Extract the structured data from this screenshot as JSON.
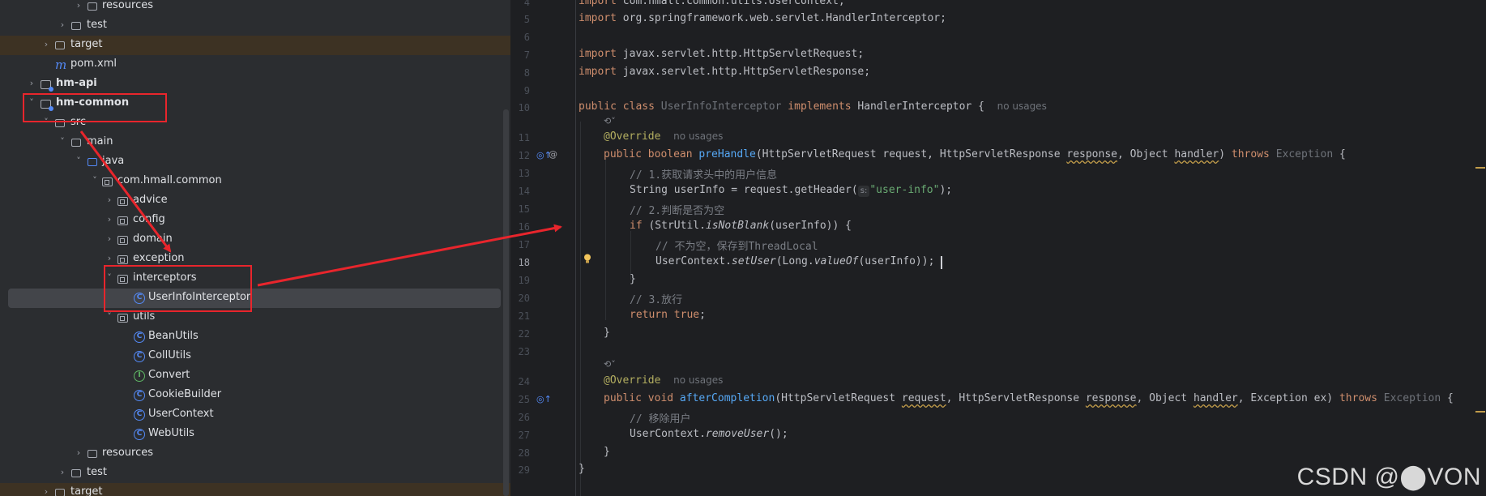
{
  "tree": {
    "items": [
      {
        "label": "resources",
        "icon": "folder-icon"
      },
      {
        "label": "test",
        "icon": "folder-icon"
      },
      {
        "label": "target",
        "icon": "folder-icon"
      },
      {
        "label": "pom.xml",
        "icon": "maven-icon"
      },
      {
        "label": "hm-api",
        "icon": "module-icon"
      },
      {
        "label": "hm-common",
        "icon": "module-icon"
      },
      {
        "label": "src",
        "icon": "folder-icon"
      },
      {
        "label": "main",
        "icon": "folder-icon"
      },
      {
        "label": "java",
        "icon": "source-folder-icon"
      },
      {
        "label": "com.hmall.common",
        "icon": "package-icon"
      },
      {
        "label": "advice",
        "icon": "package-icon"
      },
      {
        "label": "config",
        "icon": "package-icon"
      },
      {
        "label": "domain",
        "icon": "package-icon"
      },
      {
        "label": "exception",
        "icon": "package-icon"
      },
      {
        "label": "interceptors",
        "icon": "package-icon"
      },
      {
        "label": "UserInfoInterceptor",
        "icon": "class-icon"
      },
      {
        "label": "utils",
        "icon": "package-icon"
      },
      {
        "label": "BeanUtils",
        "icon": "class-icon"
      },
      {
        "label": "CollUtils",
        "icon": "class-icon"
      },
      {
        "label": "Convert",
        "icon": "interface-icon"
      },
      {
        "label": "CookieBuilder",
        "icon": "class-icon"
      },
      {
        "label": "UserContext",
        "icon": "class-icon"
      },
      {
        "label": "WebUtils",
        "icon": "class-icon"
      },
      {
        "label": "resources",
        "icon": "folder-icon"
      },
      {
        "label": "test",
        "icon": "folder-icon"
      },
      {
        "label": "target",
        "icon": "folder-icon"
      }
    ]
  },
  "editor": {
    "line_numbers": [
      "4",
      "5",
      "6",
      "7",
      "8",
      "9",
      "10",
      "11",
      "12",
      "13",
      "14",
      "15",
      "16",
      "17",
      "18",
      "19",
      "20",
      "21",
      "22",
      "23",
      "24",
      "25",
      "26",
      "27",
      "28",
      "29"
    ],
    "current_line": "18",
    "lines": {
      "l4_a": "import ",
      "l4_b": "com.hmall.common.utils.UserContext;",
      "l5_a": "import ",
      "l5_b": "org.springframework.web.servlet.HandlerInterceptor;",
      "l7_a": "import ",
      "l7_b": "javax.servlet.http.HttpServletRequest;",
      "l8_a": "import ",
      "l8_b": "javax.servlet.http.HttpServletResponse;",
      "l10_a": "public class ",
      "l10_b": "UserInfoInterceptor",
      "l10_c": " implements ",
      "l10_d": "HandlerInterceptor {",
      "l10_hint": "no usages",
      "l11_a": "@Override",
      "l11_hint": "no usages",
      "l12_a": "public boolean ",
      "l12_b": "preHandle",
      "l12_c": "(HttpServletRequest request, HttpServletResponse ",
      "l12_d": "response",
      "l12_e": ", Object ",
      "l12_f": "handler",
      "l12_g": ") ",
      "l12_h": "throws ",
      "l12_i": "Exception",
      "l12_j": " {",
      "l13": "// 1.获取请求头中的用户信息",
      "l14_a": "String userInfo = request.getHeader(",
      "l14_hint": "s:",
      "l14_b": "\"user-info\"",
      "l14_c": ");",
      "l15": "// 2.判断是否为空",
      "l16_a": "if ",
      "l16_b": "(StrUtil.",
      "l16_c": "isNotBlank",
      "l16_d": "(userInfo)) {",
      "l17": "// 不为空，保存到ThreadLocal",
      "l18_a": "UserContext.",
      "l18_b": "setUser",
      "l18_c": "(Long.",
      "l18_d": "valueOf",
      "l18_e": "(userInfo));",
      "l19": "}",
      "l20": "// 3.放行",
      "l21_a": "return ",
      "l21_b": "true",
      "l21_c": ";",
      "l22": "}",
      "l24_a": "@Override",
      "l24_hint": "no usages",
      "l25_a": "public void ",
      "l25_b": "afterCompletion",
      "l25_c": "(HttpServletRequest ",
      "l25_d": "request",
      "l25_e": ", HttpServletResponse ",
      "l25_f": "response",
      "l25_g": ", Object ",
      "l25_h": "handler",
      "l25_i": ", Exception ex) ",
      "l25_j": "throws ",
      "l25_k": "Exception",
      "l25_l": " {",
      "l26": "// 移除用户",
      "l27_a": "UserContext.",
      "l27_b": "removeUser",
      "l27_c": "();",
      "l28": "}",
      "l29": "}"
    }
  },
  "watermark": "CSDN @⬤VON",
  "colors": {
    "annotation_red": "#e8252c",
    "keyword": "#cf8e6d",
    "method": "#56a8f5",
    "string": "#6aab73"
  }
}
